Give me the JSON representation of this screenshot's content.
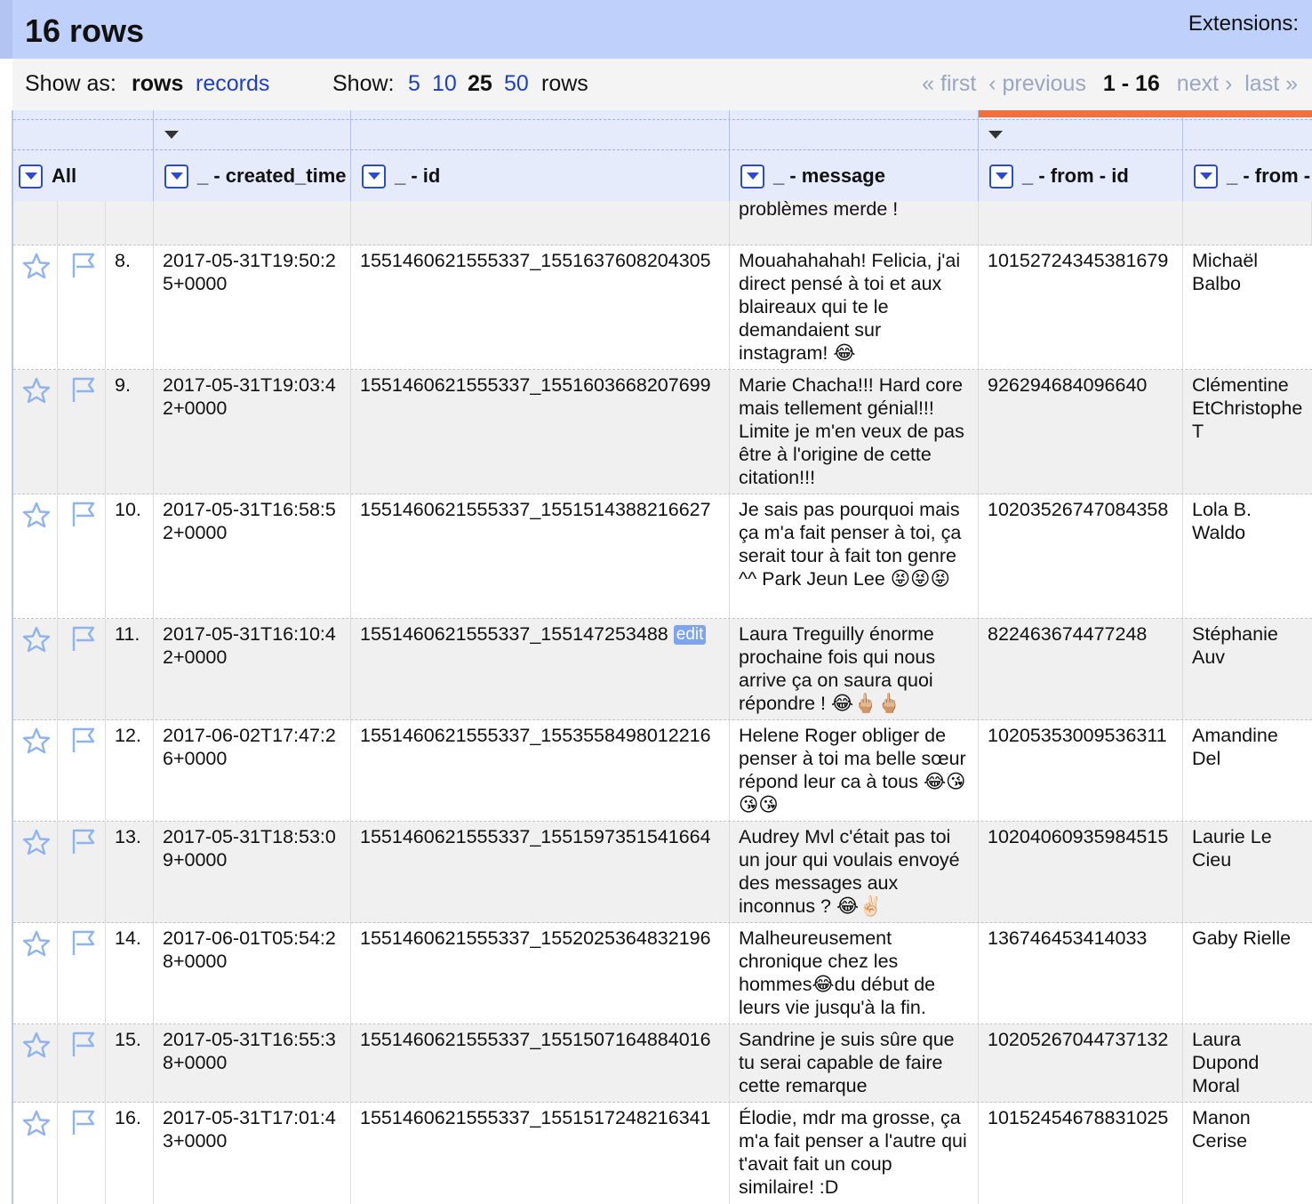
{
  "header": {
    "rows_title": "16 rows",
    "extensions_label": "Extensions:"
  },
  "controls": {
    "show_as_label": "Show as:",
    "show_as_rows": "rows",
    "show_as_records": "records",
    "show_label": "Show:",
    "show_5": "5",
    "show_10": "10",
    "show_25": "25",
    "show_50": "50",
    "show_suffix": "rows"
  },
  "pager": {
    "first": "« first",
    "previous": "‹ previous",
    "current": "1 - 16",
    "next": "next ›",
    "last": "last »"
  },
  "columns": [
    "All",
    "_ - created_time",
    "_ - id",
    "_ - message",
    "_ - from - id",
    "_ - from -"
  ],
  "partial_row": {
    "message": "aussi ça m'aurait évité des problèmes merde !"
  },
  "rows": [
    {
      "num": "8.",
      "created_time": "2017-05-31T19:50:25+0000",
      "id": "1551460621555337_1551637608204305",
      "message": "Mouahahahah! Felicia, j'ai direct pensé à toi et aux blaireaux qui te le demandaient sur instagram! 😂",
      "from_id": "10152724345381679",
      "from_name": "Michaël Balbo"
    },
    {
      "num": "9.",
      "created_time": "2017-05-31T19:03:42+0000",
      "id": "1551460621555337_1551603668207699",
      "message": "Marie Chacha!!! Hard core mais tellement génial!!! Limite je m'en veux de pas être à l'origine de cette citation!!!",
      "from_id": "926294684096640",
      "from_name": "Clémentine EtChristophe T"
    },
    {
      "num": "10.",
      "created_time": "2017-05-31T16:58:52+0000",
      "id": "1551460621555337_1551514388216627",
      "message": "Je sais pas pourquoi mais ça m'a fait penser à toi, ça serait tour à fait ton genre ^^ Park Jeun Lee 😝😝😝",
      "from_id": "10203526747084358",
      "from_name": "Lola B. Waldo"
    },
    {
      "num": "11.",
      "created_time": "2017-05-31T16:10:42+0000",
      "id": "1551460621555337_155147253488",
      "edit": "edit",
      "message": "Laura Treguilly énorme prochaine fois qui nous arrive ça on saura quoi répondre ! 😂🖕🏼🖕🏼",
      "from_id": "822463674477248",
      "from_name": "Stéphanie Auv"
    },
    {
      "num": "12.",
      "created_time": "2017-06-02T17:47:26+0000",
      "id": "1551460621555337_1553558498012216",
      "message": "Helene Roger obliger de penser à toi ma belle sœur répond leur ca à tous 😂😘😘😘",
      "from_id": "10205353009536311",
      "from_name": "Amandine Del"
    },
    {
      "num": "13.",
      "created_time": "2017-05-31T18:53:09+0000",
      "id": "1551460621555337_1551597351541664",
      "message": "Audrey Mvl c'était pas toi un jour qui voulais envoyé des messages aux inconnus ? 😂✌🏻",
      "from_id": "10204060935984515",
      "from_name": "Laurie Le Cieu"
    },
    {
      "num": "14.",
      "created_time": "2017-06-01T05:54:28+0000",
      "id": "1551460621555337_1552025364832196",
      "message": "Malheureusement chronique chez les hommes😂du début de leurs vie jusqu'à la fin.",
      "from_id": "136746453414033",
      "from_name": "Gaby Rielle"
    },
    {
      "num": "15.",
      "created_time": "2017-05-31T16:55:38+0000",
      "id": "1551460621555337_1551507164884016",
      "message": "Sandrine je suis sûre que tu serai capable de faire cette remarque",
      "from_id": "10205267044737132",
      "from_name": "Laura Dupond Moral"
    },
    {
      "num": "16.",
      "created_time": "2017-05-31T17:01:43+0000",
      "id": "1551460621555337_1551517248216341",
      "message": "Élodie, mdr ma grosse, ça m'a fait penser a l'autre qui t'avait fait un coup similaire! :D",
      "from_id": "10152454678831025",
      "from_name": "Manon Cerise"
    }
  ]
}
